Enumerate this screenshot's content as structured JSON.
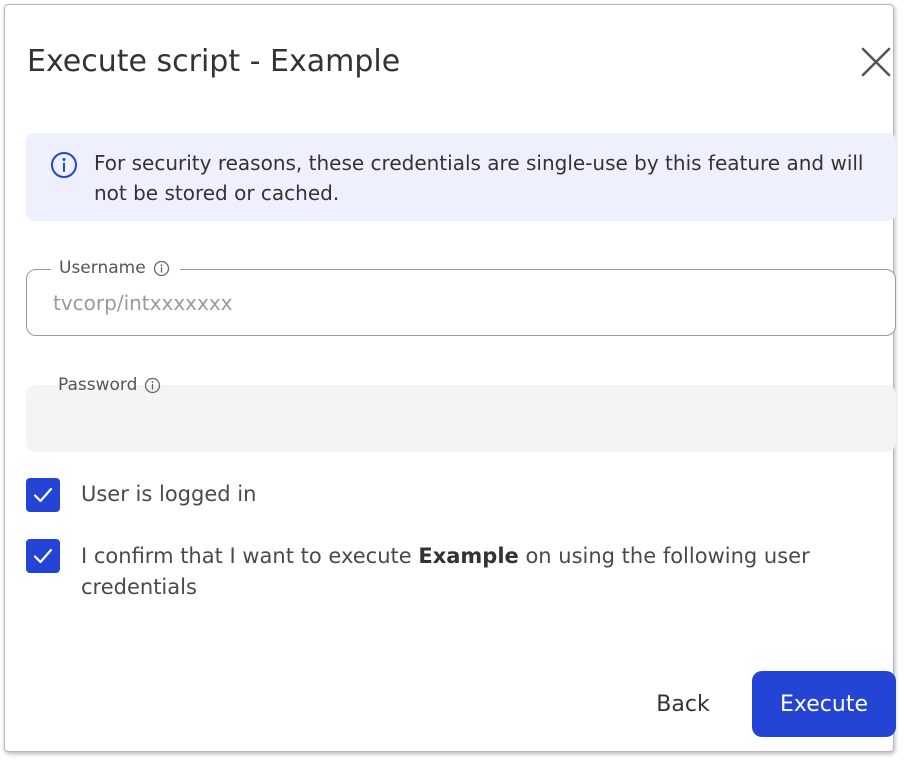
{
  "dialog": {
    "title": "Execute script - Example"
  },
  "info_banner": {
    "text": "For security reasons, these credentials are single-use by this feature and will not be stored or cached."
  },
  "username": {
    "label": "Username",
    "placeholder": "tvcorp/intxxxxxxx",
    "value": ""
  },
  "password": {
    "label": "Password",
    "value": ""
  },
  "checkboxes": [
    {
      "checked": true,
      "label": "User is logged in"
    },
    {
      "checked": true,
      "label_before": "I confirm that I want to execute ",
      "label_bold": "Example",
      "label_after": " on using the following user credentials"
    }
  ],
  "buttons": {
    "back": "Back",
    "execute": "Execute"
  },
  "icons": {
    "close": "close-icon",
    "info": "info-icon",
    "check": "checkmark-icon"
  },
  "colors": {
    "primary": "#2444d6",
    "banner_bg": "#eef1fd",
    "text": "#333333"
  }
}
